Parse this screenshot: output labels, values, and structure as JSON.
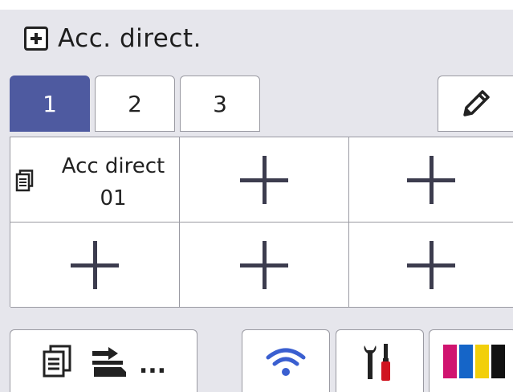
{
  "header": {
    "title": "Acc. direct.",
    "icon": "plus-box-icon"
  },
  "tabs": [
    {
      "label": "1",
      "active": true
    },
    {
      "label": "2",
      "active": false
    },
    {
      "label": "3",
      "active": false
    }
  ],
  "edit_button": {
    "icon": "pencil-icon"
  },
  "shortcuts": {
    "cell_1": {
      "icon": "document-icon",
      "line1": "Acc direct",
      "line2": "01"
    },
    "empty_icon": "add-plus-icon"
  },
  "bottom_bar": {
    "copy_scan_button": {
      "icons": [
        "copy-icon",
        "scan-icon"
      ],
      "more": "..."
    },
    "wifi_button": {
      "icon": "wifi-icon"
    },
    "settings_button": {
      "icon": "tools-icon"
    },
    "toner_button": {
      "icon": "toner-icon"
    }
  },
  "colors": {
    "active_tab": "#4e5aa0",
    "screen_bg": "#e6e6ec",
    "wifi": "#3a5fd0",
    "toner_magenta": "#d01470",
    "toner_cyan": "#1565c8",
    "toner_yellow": "#f2cf0a",
    "toner_black": "#111111"
  }
}
